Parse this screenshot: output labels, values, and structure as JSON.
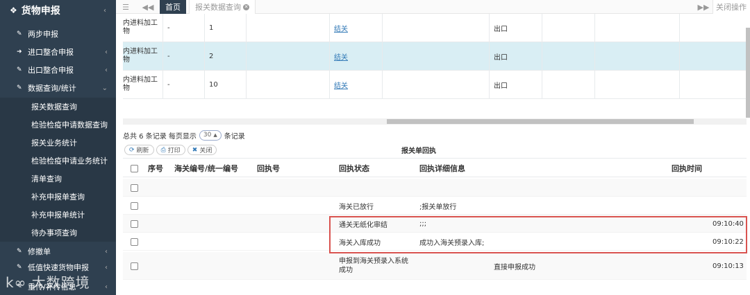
{
  "sidebar": {
    "title": "货物申报",
    "items": [
      {
        "label": "两步申报",
        "has_arrow": false
      },
      {
        "label": "进口整合申报",
        "has_arrow": true
      },
      {
        "label": "出口整合申报",
        "has_arrow": true
      },
      {
        "label": "数据查询/统计",
        "has_arrow": true,
        "expanded": true
      }
    ],
    "sub_items": [
      "报关数据查询",
      "检验检疫申请数据查询",
      "报关业务统计",
      "检验检疫申请业务统计",
      "清单查询",
      "补充申报单查询",
      "补充申报单统计",
      "待办事项查询"
    ],
    "bottom_items": [
      {
        "label": "修撤单",
        "has_arrow": true
      },
      {
        "label": "低值快速货物申报",
        "has_arrow": true
      },
      {
        "label": "重传/补传信息",
        "has_arrow": true
      }
    ],
    "watermark": "大数跨境"
  },
  "topbar": {
    "tabs": [
      {
        "label": "首页",
        "active": true
      },
      {
        "label": "报关数据查询",
        "active": false,
        "closable": true
      }
    ],
    "close_ops": "关闭操作"
  },
  "upper_table": {
    "rows": [
      {
        "c0": "内进料加工\n物",
        "c1": "-",
        "c2": "1",
        "c4": "结关",
        "c6": "出口",
        "highlight": false
      },
      {
        "c0": "内进料加工\n物",
        "c1": "-",
        "c2": "2",
        "c4": "结关",
        "c6": "出口",
        "highlight": true
      },
      {
        "c0": "内进料加工\n物",
        "c1": "-",
        "c2": "10",
        "c4": "结关",
        "c6": "出口",
        "highlight": false
      }
    ]
  },
  "pager": {
    "prefix": "总共 6 条记录 每页显示",
    "page_size": "30",
    "suffix": "条记录"
  },
  "toolbar": {
    "refresh": "刷新",
    "print": "打印",
    "close": "关闭"
  },
  "receipt": {
    "title": "报关单回执",
    "headers": {
      "seq": "序号",
      "customs_no": "海关编号/统一编号",
      "receipt_no": "回执号",
      "status": "回执状态",
      "detail": "回执详细信息",
      "time": "回执时间"
    },
    "rows": [
      {
        "status": "",
        "detail": "",
        "time": ""
      },
      {
        "status": "海关已放行",
        "detail": ";报关单放行",
        "time": ""
      },
      {
        "status": "通关无纸化审结",
        "detail": ";;;",
        "time": "09:10:40"
      },
      {
        "status": "海关入库成功",
        "detail": "成功入海关预录入库;",
        "time": "09:10:22"
      },
      {
        "status": "申报到海关预录入系统\n成功",
        "detail": "直接申报成功",
        "time": "09:10:13"
      }
    ]
  },
  "colors": {
    "sidebar_bg": "#2f4050",
    "highlight_row": "#d9eef4",
    "link": "#337ab7",
    "annotation_box": "#d9534f"
  }
}
